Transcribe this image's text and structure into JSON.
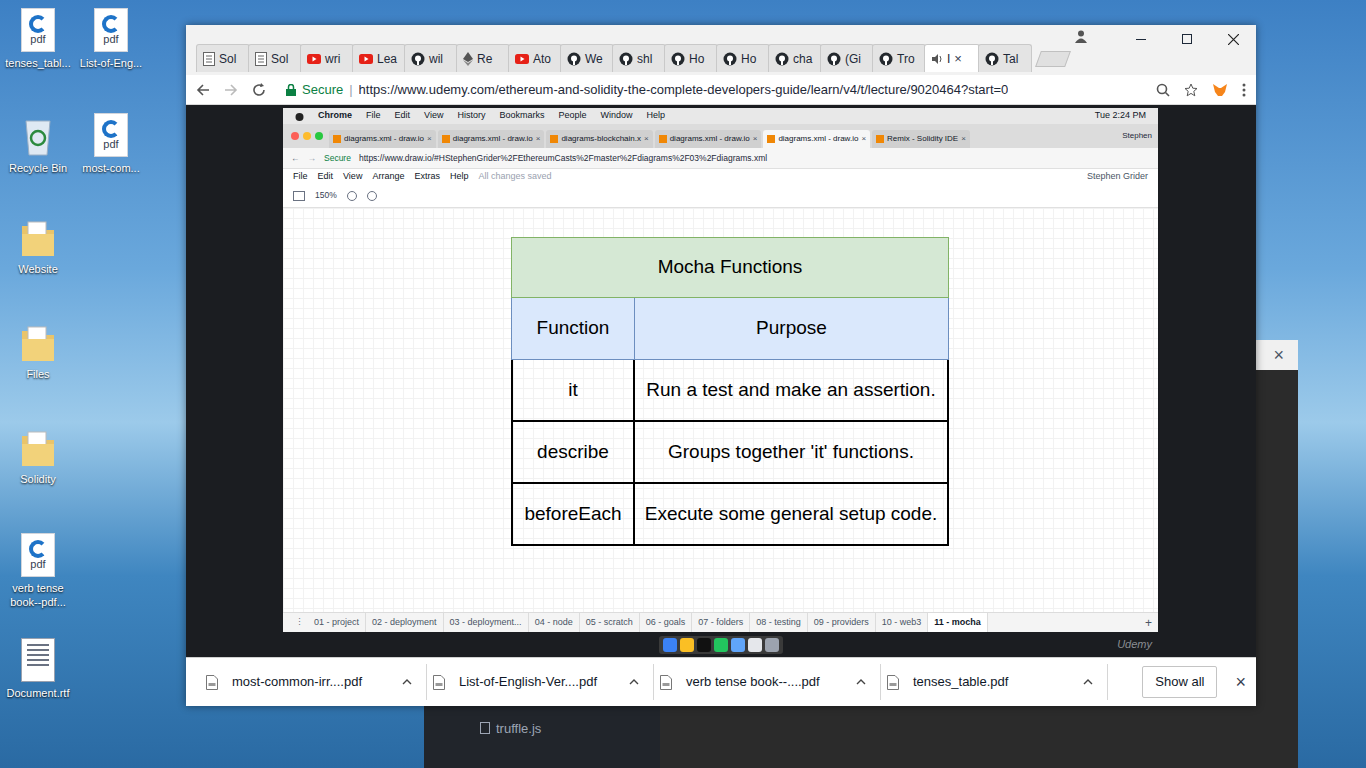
{
  "desktop": {
    "icons": [
      {
        "label": "tenses_tabl...",
        "kind": "pdf",
        "badge": "pdf"
      },
      {
        "label": "List-of-Eng...",
        "kind": "pdf",
        "badge": "pdf"
      },
      {
        "label": "Recycle Bin",
        "kind": "bin"
      },
      {
        "label": "most-com...",
        "kind": "pdf",
        "badge": "pdf"
      },
      {
        "label": "Website",
        "kind": "folder"
      },
      {
        "label": "Files",
        "kind": "folder"
      },
      {
        "label": "Solidity",
        "kind": "folder"
      },
      {
        "label": "verb tense book--pdf...",
        "kind": "pdf",
        "badge": "pdf"
      },
      {
        "label": "Document.rtf",
        "kind": "doc"
      }
    ]
  },
  "editor": {
    "close": "×",
    "files": [
      "truffle.js"
    ]
  },
  "browser": {
    "tabs": [
      {
        "label": "Sol",
        "kind": "doc",
        "selected": false
      },
      {
        "label": "Sol",
        "kind": "doc",
        "selected": false
      },
      {
        "label": "wri",
        "kind": "youtube",
        "selected": false
      },
      {
        "label": "Lea",
        "kind": "youtube",
        "selected": false
      },
      {
        "label": "wil",
        "kind": "github",
        "selected": false
      },
      {
        "label": "Re",
        "kind": "eth",
        "selected": false
      },
      {
        "label": "Ato",
        "kind": "youtube",
        "selected": false
      },
      {
        "label": "We",
        "kind": "github",
        "selected": false
      },
      {
        "label": "shl",
        "kind": "github",
        "selected": false
      },
      {
        "label": "Ho",
        "kind": "github",
        "selected": false
      },
      {
        "label": "Ho",
        "kind": "github",
        "selected": false
      },
      {
        "label": "cha",
        "kind": "github",
        "selected": false
      },
      {
        "label": "(Gi",
        "kind": "github",
        "selected": false
      },
      {
        "label": "Tro",
        "kind": "github",
        "selected": false
      },
      {
        "label": "I",
        "kind": "audio",
        "selected": true
      },
      {
        "label": "Tal",
        "kind": "github",
        "selected": false
      }
    ],
    "tab_close": "×",
    "address": {
      "secure": "Secure",
      "url": "https://www.udemy.com/ethereum-and-solidity-the-complete-developers-guide/learn/v4/t/lecture/9020464?start=0"
    },
    "video": {
      "menubar": {
        "app": "Chrome",
        "items": [
          "File",
          "Edit",
          "View",
          "History",
          "Bookmarks",
          "People",
          "Window",
          "Help"
        ],
        "clock": "Tue 2:24 PM"
      },
      "tabs": [
        {
          "label": "diagrams.xml - draw.io",
          "selected": false
        },
        {
          "label": "diagrams.xml - draw.io",
          "selected": false
        },
        {
          "label": "diagrams-blockchain.x",
          "selected": false
        },
        {
          "label": "diagrams.xml - draw.io",
          "selected": false
        },
        {
          "label": "diagrams.xml - draw.io",
          "selected": true
        },
        {
          "label": "Remix - Solidity IDE",
          "selected": false
        }
      ],
      "tab_close": "×",
      "profile": "Stephen",
      "address": {
        "secure": "Secure",
        "url": "https://www.draw.io/#HStephenGrider%2FEthereumCasts%2Fmaster%2Fdiagrams%2F03%2Fdiagrams.xml"
      },
      "menu": {
        "items": [
          "File",
          "Edit",
          "View",
          "Arrange",
          "Extras",
          "Help"
        ],
        "status": "All changes saved",
        "user": "Stephen Grider"
      },
      "zoom": "150%",
      "table": {
        "title": "Mocha Functions",
        "columns": [
          "Function",
          "Purpose"
        ],
        "rows": [
          [
            "it",
            "Run a test and make an assertion."
          ],
          [
            "describe",
            "Groups together 'it' functions."
          ],
          [
            "beforeEach",
            "Execute some general setup code."
          ]
        ]
      },
      "pages": [
        {
          "label": "01 - project",
          "selected": false
        },
        {
          "label": "02 - deployment",
          "selected": false
        },
        {
          "label": "03 - deployment...",
          "selected": false
        },
        {
          "label": "04 - node",
          "selected": false
        },
        {
          "label": "05 - scratch",
          "selected": false
        },
        {
          "label": "06 - goals",
          "selected": false
        },
        {
          "label": "07 - folders",
          "selected": false
        },
        {
          "label": "08 - testing",
          "selected": false
        },
        {
          "label": "09 - providers",
          "selected": false
        },
        {
          "label": "10 - web3",
          "selected": false
        },
        {
          "label": "11 - mocha",
          "selected": true
        }
      ],
      "add_page": "+",
      "watermark": "Udemy"
    },
    "downloads": {
      "items": [
        "most-common-irr....pdf",
        "List-of-English-Ver....pdf",
        "verb tense book--....pdf",
        "tenses_table.pdf"
      ],
      "show_all": "Show all",
      "close": "×"
    }
  }
}
